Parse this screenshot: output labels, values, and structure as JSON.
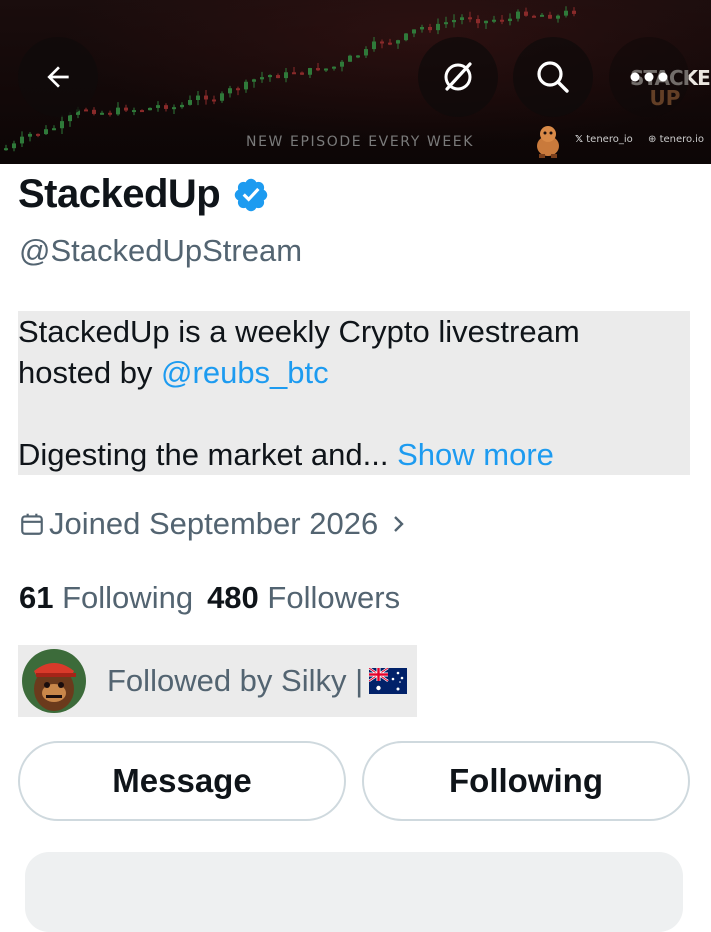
{
  "banner": {
    "tagline": "NEW EPISODE EVERY WEEK",
    "logo_line1": "STACKED",
    "logo_line2": "UP",
    "social_x": "tenero_io",
    "social_web": "tenero.io"
  },
  "header": {
    "back_icon": "arrow-left-icon",
    "grok_icon": "grok-icon",
    "search_icon": "search-icon",
    "more_icon": "more-icon"
  },
  "profile": {
    "name": "StackedUp",
    "handle": "@StackedUpStream",
    "bio_line1": "StackedUp is a weekly Crypto livestream",
    "bio_line2_prefix": "hosted by ",
    "bio_mention": "@reubs_btc",
    "bio_line3": "Digesting the market and...",
    "show_more": "Show more",
    "joined": "Joined September 2026",
    "following_count": "61",
    "following_label": "Following",
    "followers_count": "480",
    "followers_label": "Followers",
    "followed_by": "Followed by Silky | "
  },
  "actions": {
    "message_label": "Message",
    "following_label": "Following"
  },
  "colors": {
    "link": "#1d9bf0",
    "verified": "#1d9bf0",
    "secondary_text": "#536471",
    "primary_text": "#0f1419"
  }
}
